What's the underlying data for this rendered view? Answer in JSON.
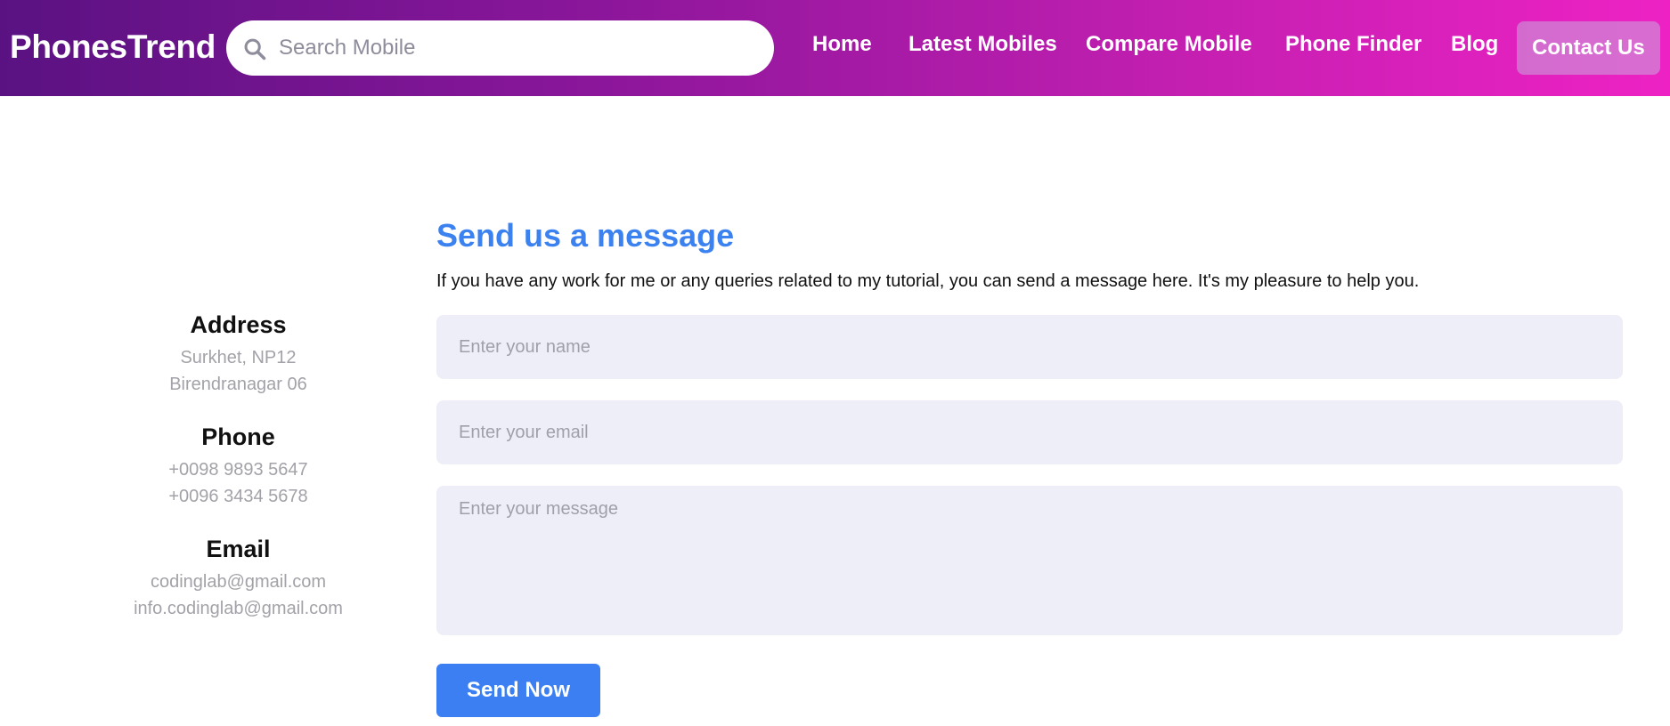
{
  "header": {
    "logo": "PhonesTrend",
    "search_placeholder": "Search Mobile",
    "nav": [
      {
        "label": "Home"
      },
      {
        "label": "Latest Mobiles"
      },
      {
        "label": "Compare Mobile"
      },
      {
        "label": "Phone Finder"
      },
      {
        "label": "Blog"
      },
      {
        "label": "Contact Us",
        "active": true
      }
    ]
  },
  "contact_info": {
    "address": {
      "title": "Address",
      "lines": [
        "Surkhet, NP12",
        "Birendranagar 06"
      ]
    },
    "phone": {
      "title": "Phone",
      "lines": [
        "+0098 9893 5647",
        "+0096 3434 5678"
      ]
    },
    "email": {
      "title": "Email",
      "lines": [
        "codinglab@gmail.com",
        "info.codinglab@gmail.com"
      ]
    }
  },
  "form": {
    "title": "Send us a message",
    "description": "If you have any work for me or any queries related to my tutorial, you can send a message here. It's my pleasure to help you.",
    "name_placeholder": "Enter your name",
    "email_placeholder": "Enter your email",
    "message_placeholder": "Enter your message",
    "submit_label": "Send Now"
  },
  "colors": {
    "header_gradient_start": "#5a1282",
    "header_gradient_end": "#ee22c4",
    "accent_blue": "#3b82f0",
    "field_bg": "#eeeef8"
  },
  "icons": {
    "search": "search-icon"
  }
}
